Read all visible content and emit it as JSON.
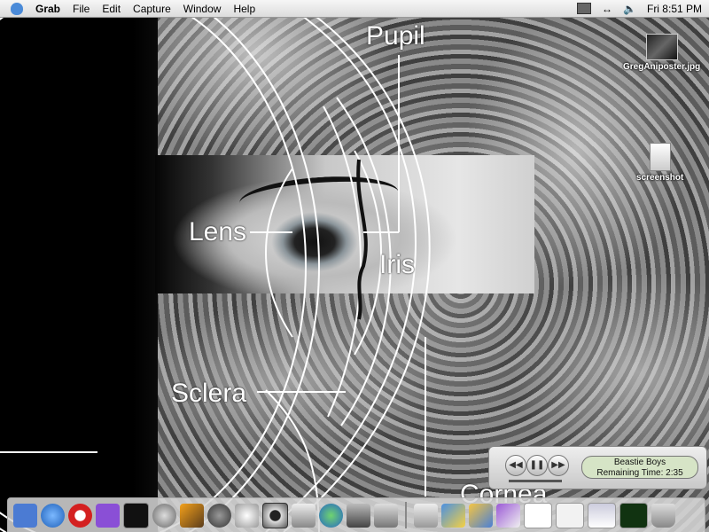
{
  "menubar": {
    "apple_icon": "apple-icon",
    "app_name": "Grab",
    "menus": [
      "File",
      "Edit",
      "Capture",
      "Window",
      "Help"
    ],
    "clock": "Fri 8:51 PM"
  },
  "desktop_icons": [
    {
      "label": "GregAniposter.jpg",
      "icon": "image-file-icon"
    },
    {
      "label": "screenshot",
      "icon": "tiff-file-icon"
    }
  ],
  "diagram_labels": {
    "pupil": "Pupil",
    "lens": "Lens",
    "iris": "Iris",
    "sclera": "Sclera",
    "cornea": "Cornea"
  },
  "player": {
    "rewind_icon": "rewind-icon",
    "pause_icon": "pause-icon",
    "forward_icon": "fast-forward-icon",
    "artist": "Beastie Boys",
    "remaining": "Remaining Time: 2:35"
  },
  "dock": {
    "items": [
      "finder-icon",
      "internet-icon",
      "opera-icon",
      "mail-icon",
      "terminal-icon",
      "quicktime-icon",
      "iphoto-icon",
      "grab-icon",
      "settings-icon",
      "eye-icon",
      "preferences-icon",
      "ichat-icon",
      "network-icon",
      "calculator-icon",
      "hard-drive-icon",
      "app-icon",
      "folder-icon",
      "app2-icon",
      "window-thumb-icon",
      "window-thumb-icon",
      "window-thumb-icon",
      "window-thumb-icon",
      "trash-icon"
    ]
  }
}
